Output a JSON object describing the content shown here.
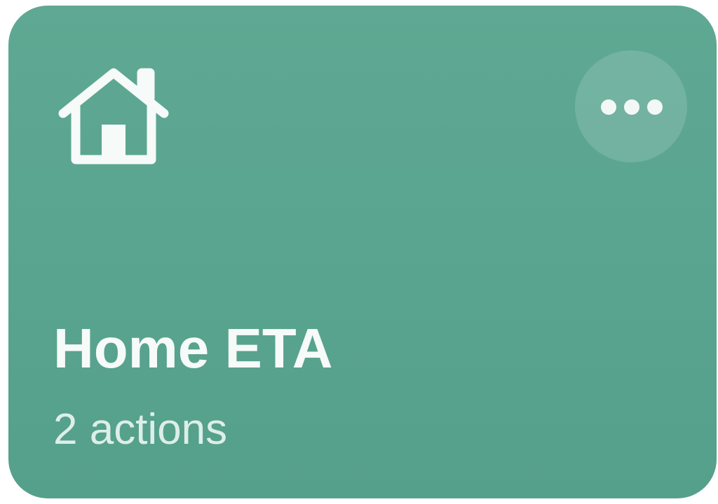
{
  "shortcut": {
    "icon": "house-icon",
    "title": "Home ETA",
    "subtitle": "2 actions",
    "menu_icon": "ellipsis-icon",
    "color": "#5aa590"
  }
}
